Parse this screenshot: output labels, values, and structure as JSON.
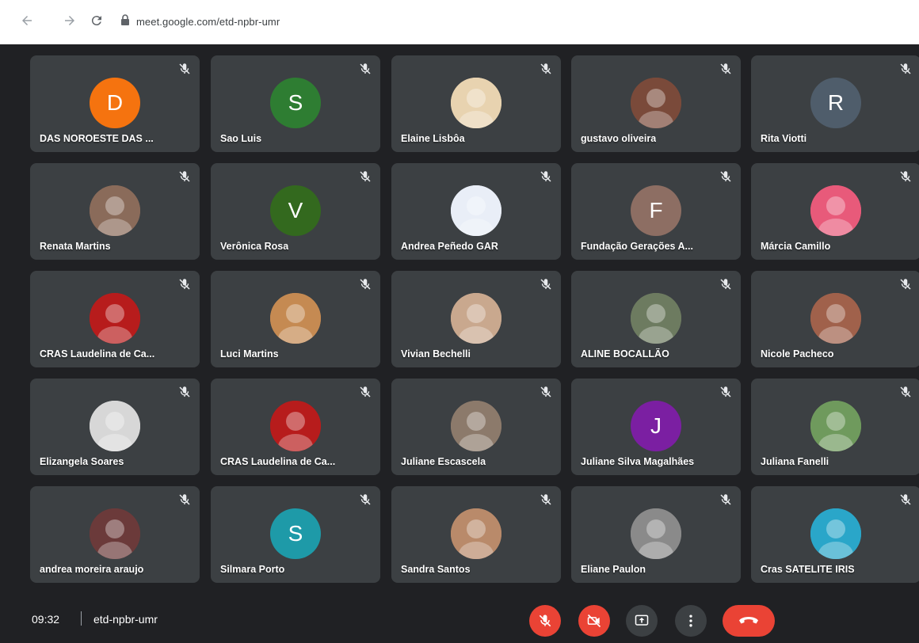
{
  "browser": {
    "url": "meet.google.com/etd-npbr-umr"
  },
  "participants": [
    {
      "name": "DAS NOROESTE DAS ...",
      "avatar_type": "letter",
      "letter": "D",
      "color": "#f5730f"
    },
    {
      "name": "Sao Luis",
      "avatar_type": "letter",
      "letter": "S",
      "color": "#2e7d32"
    },
    {
      "name": "Elaine Lisbôa",
      "avatar_type": "photo",
      "color": "#e8d3b0"
    },
    {
      "name": "gustavo oliveira",
      "avatar_type": "photo",
      "color": "#7a4a3a"
    },
    {
      "name": "Rita Viotti",
      "avatar_type": "letter",
      "letter": "R",
      "color": "#4f5d6b"
    },
    {
      "name": "Renata Martins",
      "avatar_type": "photo",
      "color": "#8a6b5a"
    },
    {
      "name": "Verônica Rosa",
      "avatar_type": "letter",
      "letter": "V",
      "color": "#33691e"
    },
    {
      "name": "Andrea Peñedo GAR",
      "avatar_type": "photo",
      "color": "#e9eef7"
    },
    {
      "name": "Fundação Gerações A...",
      "avatar_type": "letter",
      "letter": "F",
      "color": "#8d6e63"
    },
    {
      "name": "Márcia Camillo",
      "avatar_type": "photo",
      "color": "#e85a7a"
    },
    {
      "name": "CRAS Laudelina de Ca...",
      "avatar_type": "photo",
      "color": "#b71c1c"
    },
    {
      "name": "Luci Martins",
      "avatar_type": "photo",
      "color": "#c58a52"
    },
    {
      "name": "Vivian Bechelli",
      "avatar_type": "photo",
      "color": "#c9a88e"
    },
    {
      "name": "ALINE BOCALLÃO",
      "avatar_type": "photo",
      "color": "#6d7b60"
    },
    {
      "name": "Nicole Pacheco",
      "avatar_type": "photo",
      "color": "#a0614b"
    },
    {
      "name": "Elizangela Soares",
      "avatar_type": "photo",
      "color": "#d7d7d7"
    },
    {
      "name": "CRAS Laudelina de Ca...",
      "avatar_type": "photo",
      "color": "#b71c1c"
    },
    {
      "name": "Juliane Escascela",
      "avatar_type": "photo",
      "color": "#8c7a6b"
    },
    {
      "name": "Juliane Silva Magalhães",
      "avatar_type": "letter",
      "letter": "J",
      "color": "#7b1fa2"
    },
    {
      "name": "Juliana Fanelli",
      "avatar_type": "photo",
      "color": "#6f9a5d"
    },
    {
      "name": "andrea moreira araujo",
      "avatar_type": "photo",
      "color": "#6b3a3a"
    },
    {
      "name": "Silmara Porto",
      "avatar_type": "letter",
      "letter": "S",
      "color": "#1e9aa8"
    },
    {
      "name": "Sandra Santos",
      "avatar_type": "photo",
      "color": "#b98a6a"
    },
    {
      "name": "Eliane Paulon",
      "avatar_type": "photo",
      "color": "#8a8a8a"
    },
    {
      "name": "Cras SATELITE IRIS",
      "avatar_type": "photo",
      "color": "#2aa6c9"
    }
  ],
  "meeting": {
    "time": "09:32",
    "code": "etd-npbr-umr"
  },
  "controls": [
    {
      "name": "mic-off-button",
      "icon": "mic-off-icon",
      "bg": "#ea4335"
    },
    {
      "name": "camera-off-button",
      "icon": "videocam-off-icon",
      "bg": "#ea4335"
    },
    {
      "name": "present-button",
      "icon": "present-screen-icon",
      "bg": "#3c4043"
    },
    {
      "name": "more-options-button",
      "icon": "more-vert-icon",
      "bg": "#3c4043"
    },
    {
      "name": "leave-call-button",
      "icon": "call-end-icon",
      "bg": "#ea4335"
    }
  ]
}
